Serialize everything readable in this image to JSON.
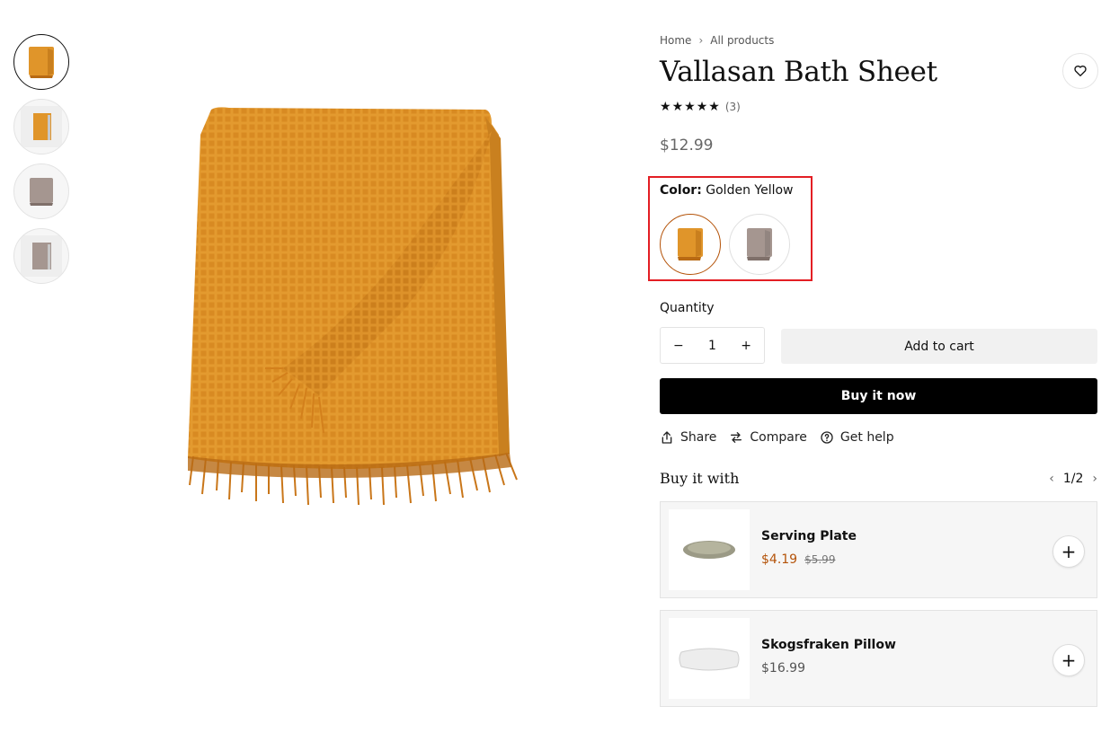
{
  "breadcrumb": {
    "home": "Home",
    "current": "All products"
  },
  "product": {
    "title": "Vallasan Bath Sheet",
    "rating_count": "(3)",
    "price": "$12.99",
    "color_label": "Color:",
    "color_value": "Golden Yellow"
  },
  "colors": {
    "golden": "#e0952a",
    "golden_dark": "#b86a14",
    "taupe": "#a59690",
    "taupe_dark": "#7f706a",
    "accent": "#b45309"
  },
  "quantity": {
    "label": "Quantity",
    "value": "1",
    "minus": "−",
    "plus": "+"
  },
  "buttons": {
    "add_to_cart": "Add to cart",
    "buy_now": "Buy it now"
  },
  "actions": {
    "share": "Share",
    "compare": "Compare",
    "help": "Get help"
  },
  "buy_with": {
    "title": "Buy it with",
    "page": "1/2",
    "items": [
      {
        "name": "Serving Plate",
        "sale_price": "$4.19",
        "old_price": "$5.99"
      },
      {
        "name": "Skogsfraken Pillow",
        "price": "$16.99"
      }
    ]
  }
}
